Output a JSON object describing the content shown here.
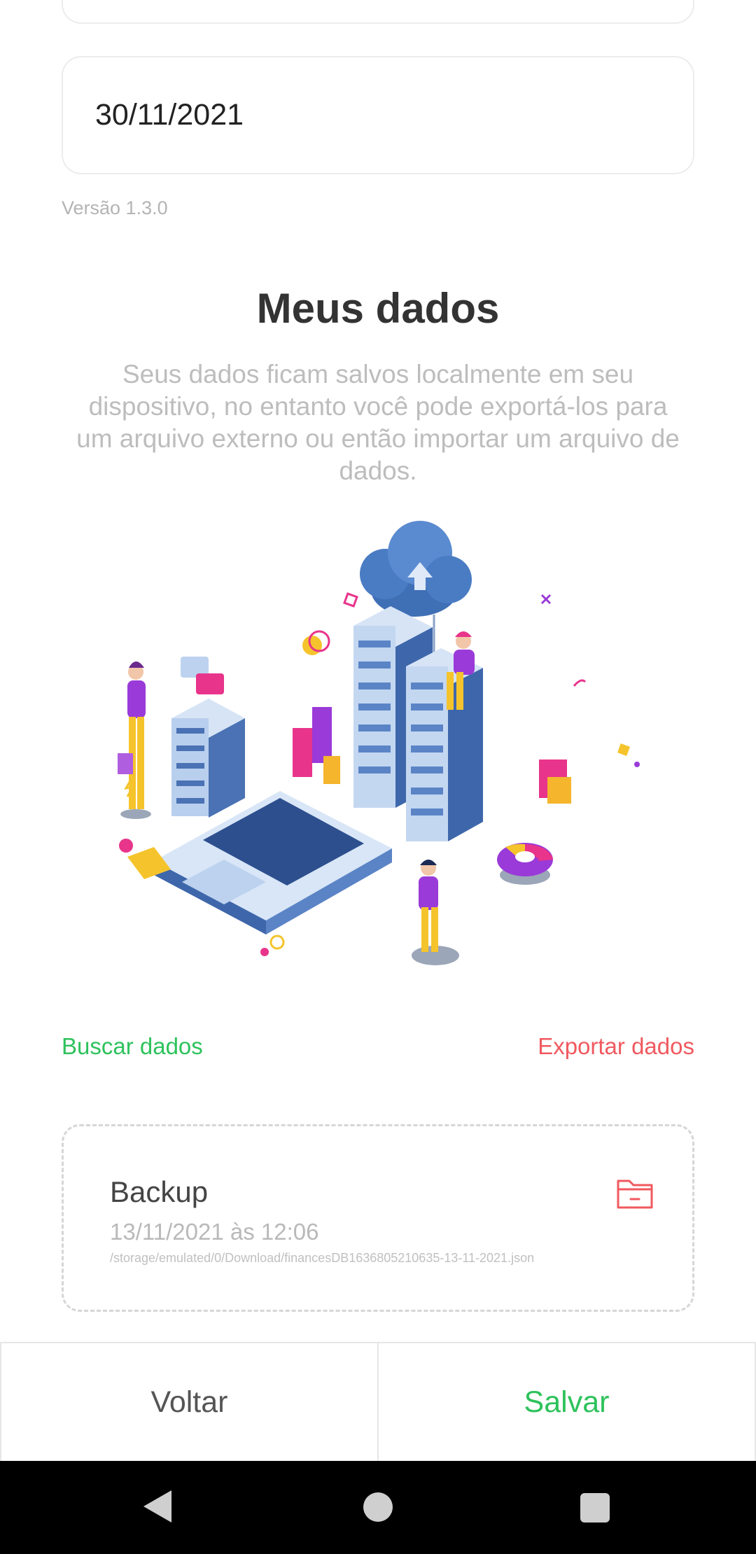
{
  "form": {
    "date_value": "30/11/2021",
    "version_text": "Versão 1.3.0"
  },
  "data_section": {
    "title": "Meus dados",
    "description": "Seus dados ficam salvos localmente em seu dispositivo, no entanto você pode exportá-los para um arquivo externo ou então importar um arquivo de dados.",
    "illustration_icon": "data-servers-cloud-illustration",
    "fetch_label": "Buscar dados",
    "export_label": "Exportar dados",
    "colors": {
      "fetch": "#2ec25c",
      "export": "#f0595f"
    }
  },
  "backup": {
    "title": "Backup",
    "date": "13/11/2021 às 12:06",
    "path": "/storage/emulated/0/Download/financesDB1636805210635-13-11-2021.json",
    "icon": "folder-remove-icon"
  },
  "bottom_bar": {
    "back_label": "Voltar",
    "save_label": "Salvar"
  },
  "system_nav": {
    "back_icon": "nav-back-icon",
    "home_icon": "nav-home-icon",
    "recent_icon": "nav-recents-icon"
  }
}
